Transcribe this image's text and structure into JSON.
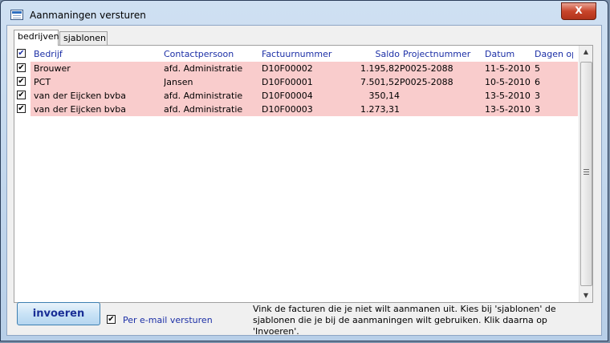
{
  "window": {
    "title": "Aanmaningen versturen",
    "close_label": "X"
  },
  "tabs": [
    {
      "label": "bedrijven"
    },
    {
      "label": "sjablonen"
    }
  ],
  "table": {
    "headers": [
      "Bedrijf",
      "Contactpersoon",
      "Factuurnummer",
      "Saldo",
      "Projectnummer",
      "Datum",
      "Dagen op"
    ],
    "rows": [
      {
        "bedrijf": "Brouwer",
        "contact": "afd. Administratie",
        "factuur": "D10F00002",
        "saldo": "1.195,82",
        "project": "P0025-2088",
        "datum": "11-5-2010",
        "dagen": "5"
      },
      {
        "bedrijf": "PCT",
        "contact": "Jansen",
        "factuur": "D10F00001",
        "saldo": "7.501,52",
        "project": "P0025-2088",
        "datum": "10-5-2010",
        "dagen": "6"
      },
      {
        "bedrijf": "van der Eijcken bvba",
        "contact": "afd. Administratie",
        "factuur": "D10F00004",
        "saldo": "350,14",
        "project": "",
        "datum": "13-5-2010",
        "dagen": "3"
      },
      {
        "bedrijf": "van der Eijcken bvba",
        "contact": "afd. Administratie",
        "factuur": "D10F00003",
        "saldo": "1.273,31",
        "project": "",
        "datum": "13-5-2010",
        "dagen": "3"
      }
    ]
  },
  "footer": {
    "button_label": "invoeren",
    "email_label": "Per e-mail versturen",
    "instructions": "Vink de facturen die je niet wilt aanmanen uit. Kies bij 'sjablonen' de sjablonen die je bij de aanmaningen wilt gebruiken. Klik daarna op 'Invoeren'."
  },
  "checkbox_mark": "✔",
  "colors": {
    "row_highlight": "#f9cccc",
    "header_text": "#1c2fa6",
    "close_button": "#c8452b"
  }
}
